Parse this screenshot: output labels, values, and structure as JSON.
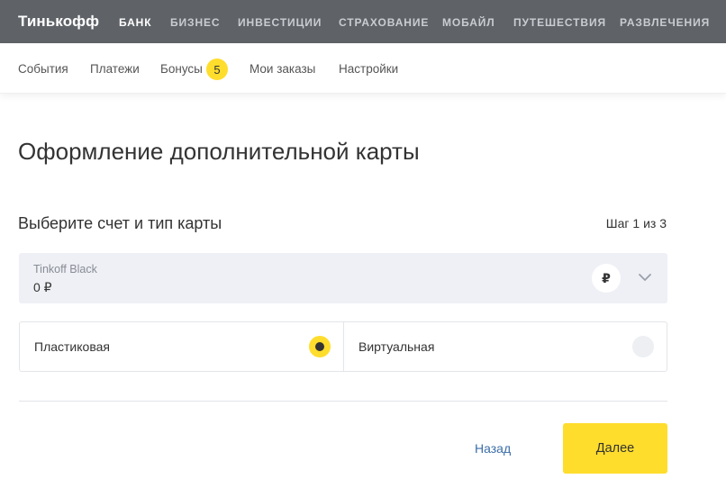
{
  "brand": {
    "logo": "Тинькофф"
  },
  "top_nav": {
    "items": [
      "Банк",
      "Бизнес",
      "Инвестиции",
      "Страхование",
      "Мобайл",
      "Путешествия",
      "Развлечения"
    ],
    "active_index": 0
  },
  "sub_nav": {
    "items": [
      "События",
      "Платежи",
      "Бонусы",
      "Мои заказы",
      "Настройки"
    ],
    "bonus_badge": "5"
  },
  "page": {
    "title": "Оформление дополнительной карты",
    "section_title": "Выберите счет и тип карты",
    "step": "Шаг 1 из 3"
  },
  "account": {
    "name": "Tinkoff Black",
    "balance": "0 ₽",
    "currency_symbol": "₽"
  },
  "card_types": {
    "options": [
      {
        "label": "Пластиковая",
        "selected": true
      },
      {
        "label": "Виртуальная",
        "selected": false
      }
    ]
  },
  "actions": {
    "back_label": "Назад",
    "next_label": "Далее"
  },
  "colors": {
    "accent": "#ffdd2d",
    "topbar": "#5f6368",
    "link": "#3c6ea8",
    "field_bg": "#eef0f5"
  }
}
